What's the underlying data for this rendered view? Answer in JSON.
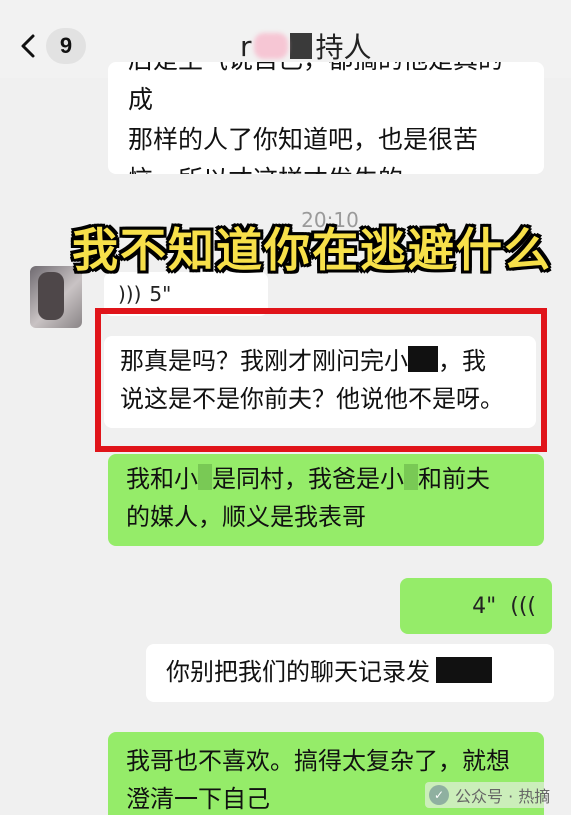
{
  "header": {
    "back_icon": "chevron-left-icon",
    "unread_count": "9",
    "title_prefix": "r",
    "title_suffix": "持人"
  },
  "messages": [
    {
      "side": "left",
      "type": "text",
      "lines": [
        "那样的人了你知道吧，也是很苦",
        "恼，所以才这样才发生的。"
      ],
      "cut_line": "后是生气说自己，都搞的他是真的成"
    },
    {
      "type": "timestamp",
      "text": "20:10"
    },
    {
      "side": "left",
      "type": "voice",
      "duration": "5\"",
      "icon": "voice-wave-icon"
    },
    {
      "side": "left",
      "type": "text",
      "highlighted": true,
      "line1_a": "那真是吗？我刚才刚问完小",
      "line1_b": "，我",
      "line2": "说这是不是你前夫？他说他不是呀。"
    },
    {
      "side": "right",
      "type": "text",
      "line1_a": "我和小",
      "line1_b": "是同村，我爸是小",
      "line1_c": "和前夫",
      "line2": "的媒人，顺义是我表哥"
    },
    {
      "side": "right",
      "type": "voice",
      "duration": "4\"",
      "icon": "voice-wave-icon"
    },
    {
      "side": "left",
      "type": "text",
      "line1": "你别把我们的聊天记录发"
    },
    {
      "side": "left",
      "type": "text",
      "line1": "我哥也不喜欢。搞得太复杂了，就想",
      "line2": "澄清一下自己"
    }
  ],
  "overlay_caption": "我不知道你在逃避什么",
  "watermark": {
    "text": "公众号 · 热摘"
  },
  "colors": {
    "green_bubble": "#95ec69",
    "white_bubble": "#ffffff",
    "highlight_border": "#e0141a",
    "caption_fill": "#f7e04a",
    "background": "#f0f0f0"
  }
}
